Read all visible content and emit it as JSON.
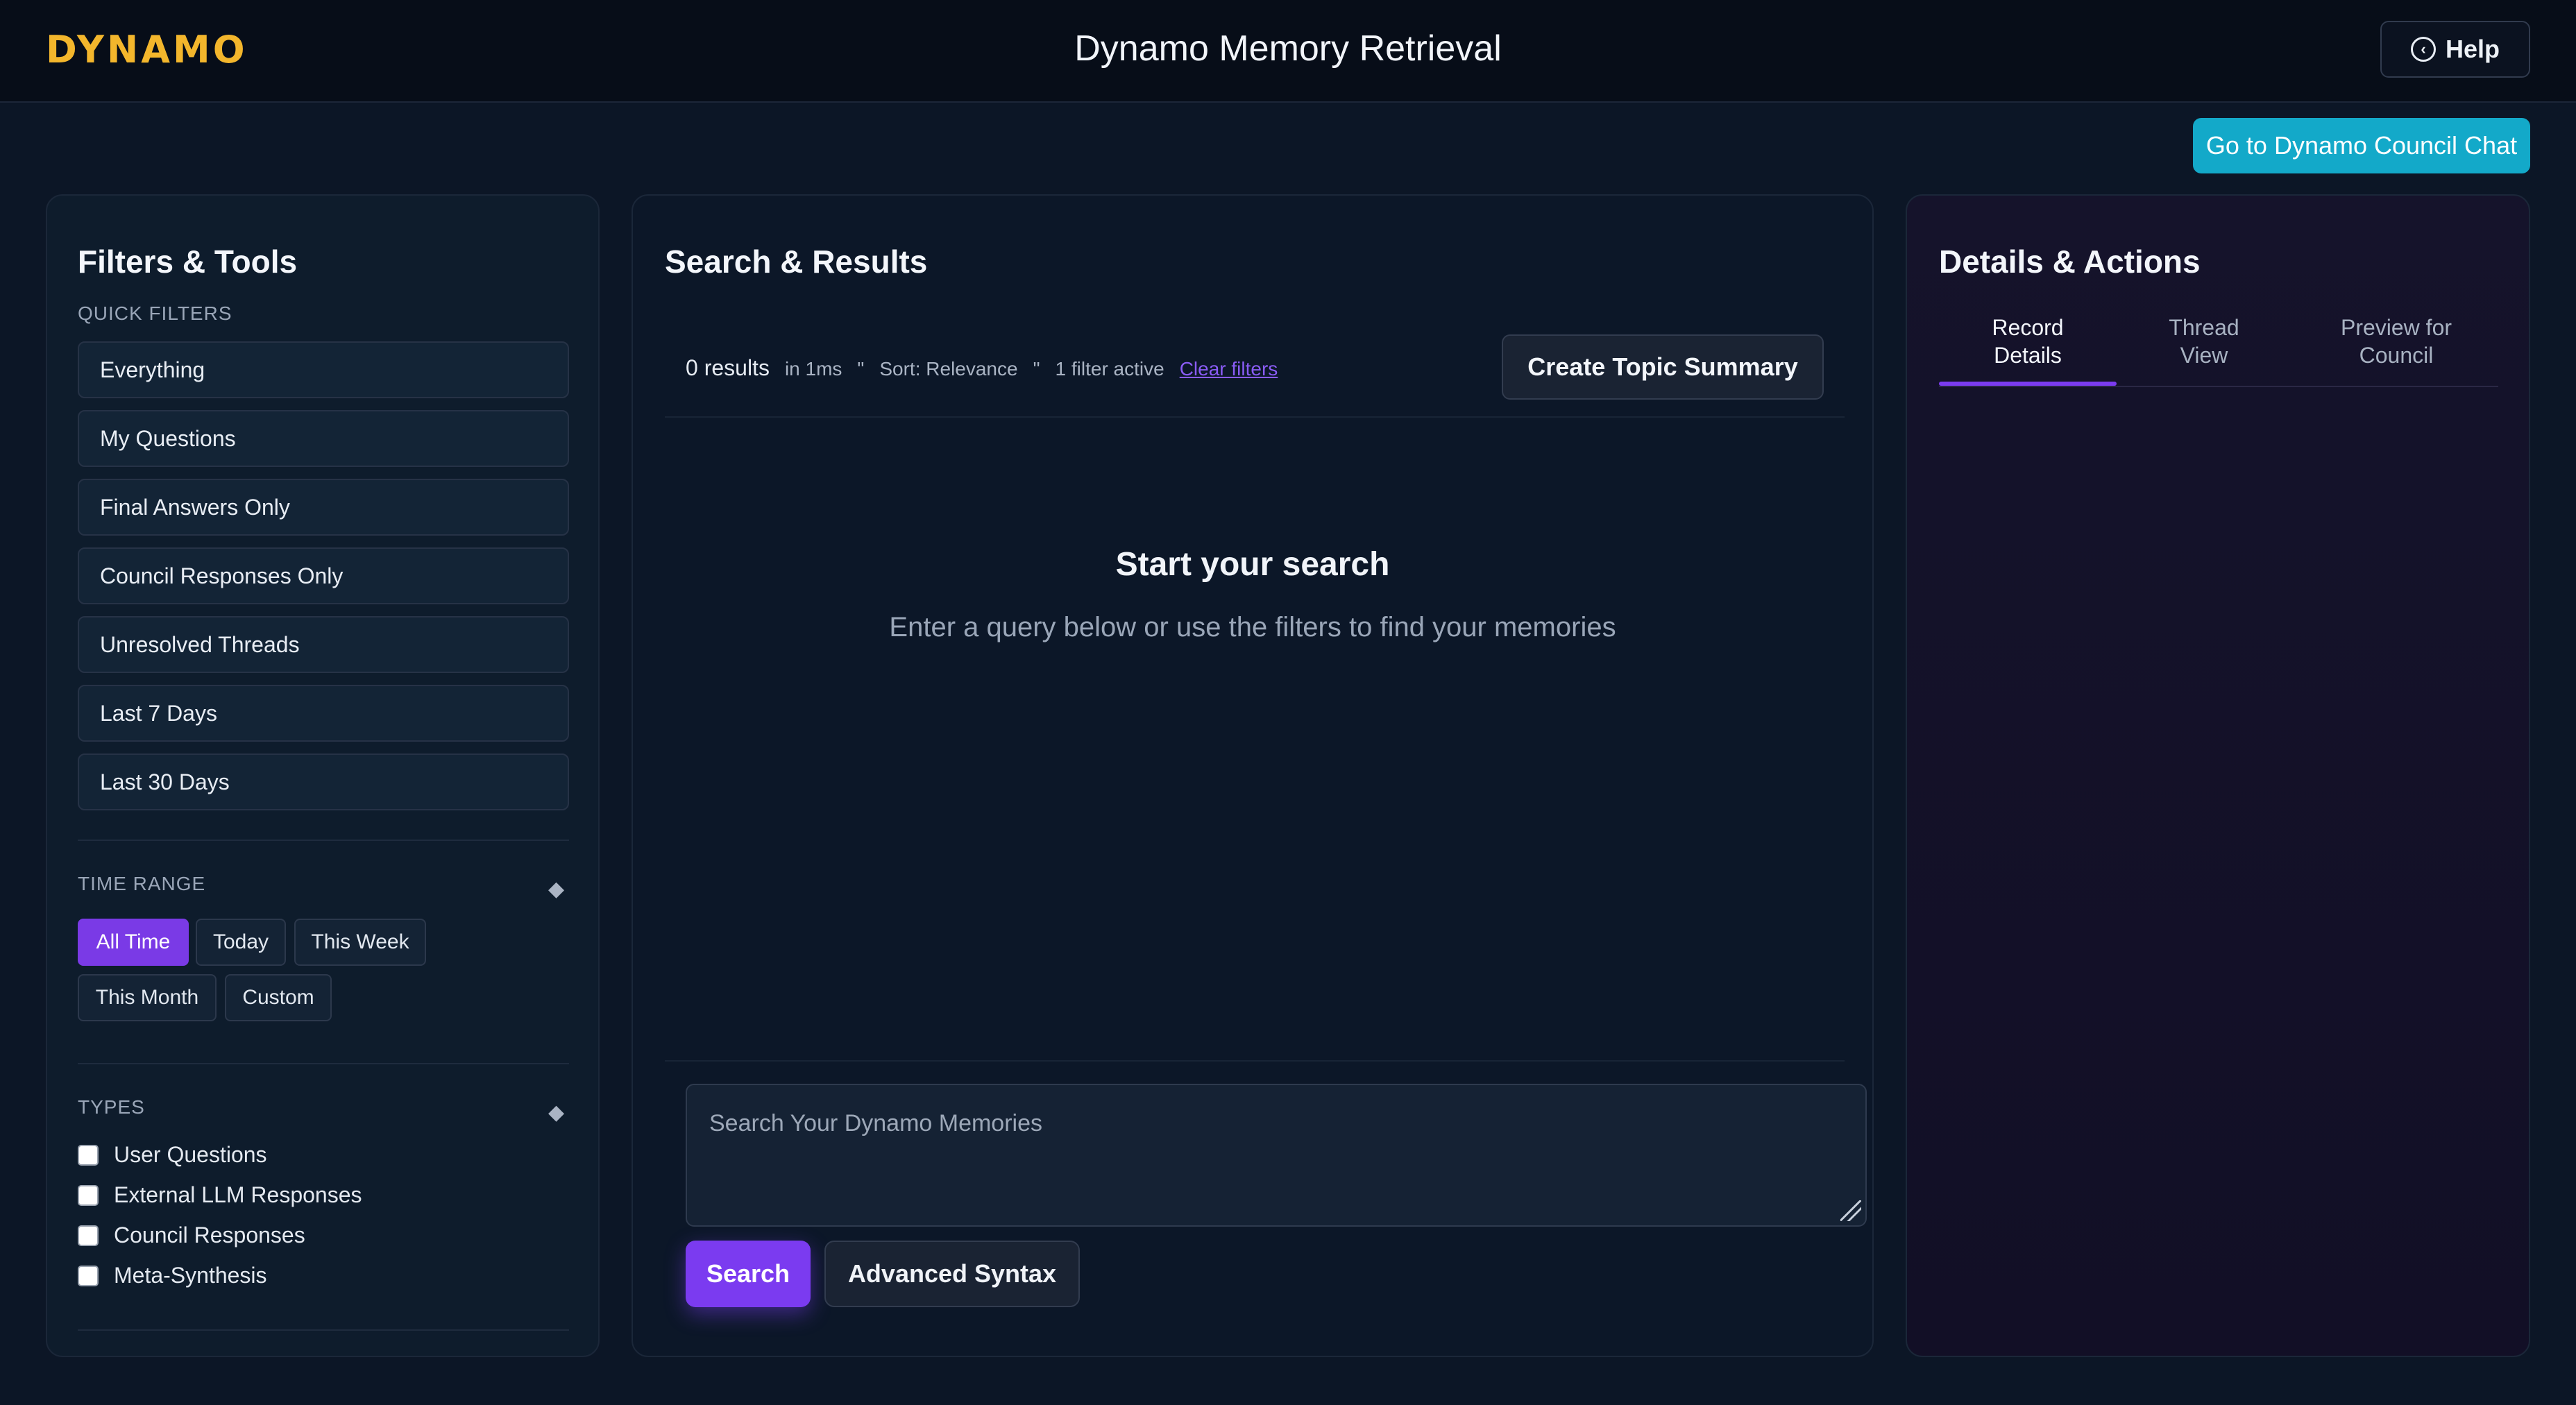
{
  "header": {
    "brand": "DYNAMO",
    "title": "Dynamo Memory Retrieval",
    "help_label": "Help",
    "help_icon": "circle-arrow-icon"
  },
  "council_button_label": "Go to Dynamo Council Chat",
  "left_panel": {
    "title": "Filters & Tools",
    "quick_filters_label": "QUICK FILTERS",
    "quick_filters": [
      "Everything",
      "My Questions",
      "Final Answers Only",
      "Council Responses Only",
      "Unresolved Threads",
      "Last 7 Days",
      "Last 30 Days"
    ],
    "time_range_label": "TIME RANGE",
    "time_range_options": [
      "All Time",
      "Today",
      "This Week",
      "This Month",
      "Custom"
    ],
    "time_range_selected": "All Time",
    "types_label": "TYPES",
    "types": [
      "User Questions",
      "External LLM Responses",
      "Council Responses",
      "Meta-Synthesis"
    ],
    "collapse_glyph": "◆"
  },
  "mid_panel": {
    "title": "Search & Results",
    "result_count": "0 results",
    "timing": "in 1ms",
    "separator": "\"",
    "sort": "Sort: Relevance",
    "filters_active": "1 filter active",
    "clear_filters": "Clear filters",
    "summary_button": "Create Topic Summary",
    "empty_title": "Start your search",
    "empty_subtitle": "Enter a query below or use the filters to find your memories",
    "search_placeholder": "Search Your Dynamo Memories",
    "search_button": "Search",
    "advanced_button": "Advanced Syntax"
  },
  "right_panel": {
    "title": "Details & Actions",
    "tabs": [
      {
        "line1": "Record",
        "line2": "Details"
      },
      {
        "line1": "Thread",
        "line2": "View"
      },
      {
        "line1": "Preview for",
        "line2": "Council"
      }
    ],
    "active_tab": "Record Details"
  },
  "colors": {
    "brand": "#f3b62c",
    "accent": "#7b3bf0",
    "council_button": "#13a9c9",
    "background": "#0c1626"
  }
}
